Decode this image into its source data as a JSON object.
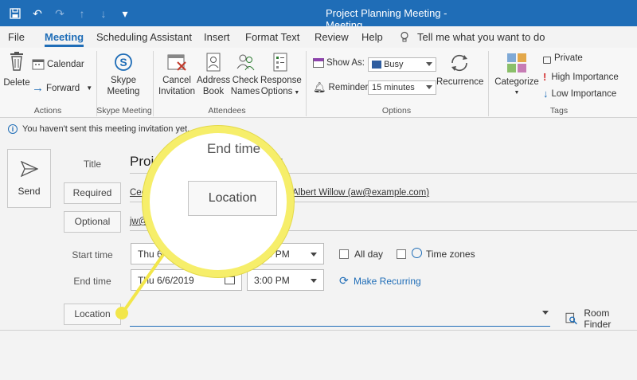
{
  "window": {
    "title": "Project Planning Meeting  -  Meeting"
  },
  "menu": {
    "items": [
      "File",
      "Meeting",
      "Scheduling Assistant",
      "Insert",
      "Format Text",
      "Review",
      "Help"
    ],
    "active": "Meeting",
    "tell_me": "Tell me what you want to do"
  },
  "ribbon": {
    "actions": {
      "delete": "Delete",
      "calendar": "Calendar",
      "forward": "Forward",
      "label": "Actions"
    },
    "skype": {
      "button_line1": "Skype",
      "button_line2": "Meeting",
      "label": "Skype Meeting"
    },
    "attendees": {
      "cancel_line1": "Cancel",
      "cancel_line2": "Invitation",
      "address_line1": "Address",
      "address_line2": "Book",
      "check_line1": "Check",
      "check_line2": "Names",
      "response_line1": "Response",
      "response_line2": "Options",
      "label": "Attendees"
    },
    "options": {
      "show_as_label": "Show As:",
      "show_as_value": "Busy",
      "reminder_label": "Reminder:",
      "reminder_value": "15 minutes",
      "recurrence": "Recurrence",
      "label": "Options"
    },
    "tags": {
      "categorize": "Categorize",
      "private": "Private",
      "high": "High Importance",
      "low": "Low Importance",
      "label": "Tags"
    }
  },
  "info": {
    "message": "You haven't sent this meeting invitation yet."
  },
  "form": {
    "send": "Send",
    "title_label": "Title",
    "title_value": "Project Pl",
    "title_tail": "g",
    "required_label": "Required",
    "required_value_1": "Cecilia Smi",
    "required_value_2": "Albert Willow (aw@example.com)",
    "optional_label": "Optional",
    "optional_value": "jw@email.co",
    "start_label": "Start time",
    "start_date": "Thu 6/6/2019",
    "start_time": "1:00 PM",
    "all_day": "All day",
    "time_zones": "Time zones",
    "end_label": "End time",
    "end_date": "Thu 6/6/2019",
    "end_time": "3:00 PM",
    "make_recurring": "Make Recurring",
    "location_label": "Location",
    "room_finder": "Room Finder"
  },
  "magnifier": {
    "end_time": "End time",
    "location": "Location"
  },
  "colors": {
    "accent": "#1f6db7",
    "highlight": "#f6ee6a"
  }
}
